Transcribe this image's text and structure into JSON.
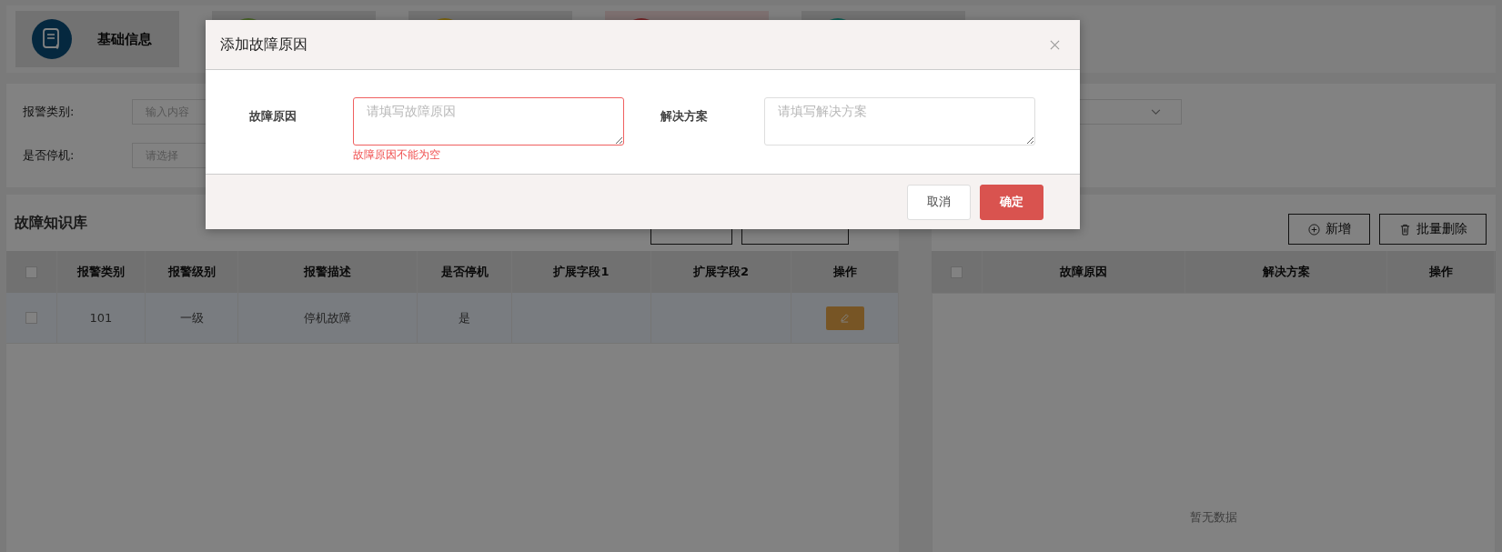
{
  "tabs": [
    {
      "label": "基础信息"
    }
  ],
  "filters": [
    {
      "label": "报警类别:",
      "placeholder": "输入内容"
    },
    {
      "label": "是否停机:",
      "placeholder": "请选择"
    }
  ],
  "knowledge_base": {
    "title": "故障知识库",
    "buttons": [
      {
        "kind": "add"
      },
      {
        "kind": "delete"
      }
    ],
    "columns": [
      "报警类别",
      "报警级别",
      "报警描述",
      "是否停机",
      "扩展字段1",
      "扩展字段2",
      "操作"
    ],
    "select_all_checked": false,
    "rows": [
      {
        "alarm_type": "101",
        "alarm_level": "一级",
        "description": "停机故障",
        "shutdown": "是",
        "checked": false
      }
    ]
  },
  "causes": {
    "buttons": [
      {
        "label": "新增",
        "kind": "add"
      },
      {
        "label": "批量删除",
        "kind": "delete"
      }
    ],
    "select_all_checked": false,
    "columns": [
      "故障原因",
      "解决方案",
      "操作"
    ],
    "empty_text": "暂无数据"
  },
  "dialog": {
    "title": "添加故障原因",
    "fields": [
      {
        "label": "故障原因",
        "placeholder": "请填写故障原因",
        "error": "故障原因不能为空"
      },
      {
        "label": "解决方案",
        "placeholder": "请填写解决方案"
      }
    ],
    "buttons": [
      {
        "label": "取消",
        "kind": "secondary"
      },
      {
        "label": "确定",
        "kind": "primary"
      }
    ]
  }
}
